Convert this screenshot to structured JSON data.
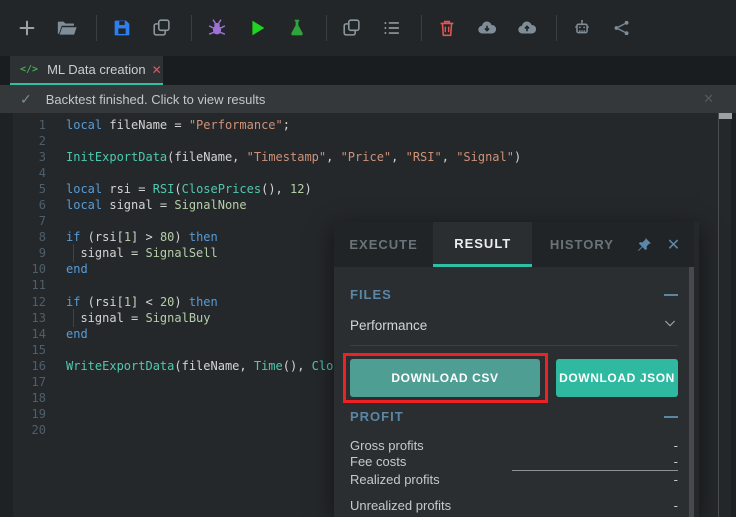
{
  "colors": {
    "accent_teal": "#2dc0a6",
    "csv_button": "#4f9e94",
    "json_button": "#2fb9a1",
    "section_header": "#5b87a5",
    "annotation_red": "#ee2222",
    "tokens": {
      "kw": "#569cd6",
      "fn": "#4ec9b0",
      "str": "#ce9178",
      "num": "#b5cea8",
      "pl": "#d4d4d4"
    }
  },
  "toolbar": {
    "groups": [
      [
        {
          "name": "new-script",
          "icon": "plus",
          "color": "#9aa2a8"
        },
        {
          "name": "open-script",
          "icon": "folder-open",
          "color": "#7e8d98"
        }
      ],
      [
        {
          "name": "save-script",
          "icon": "floppy",
          "color": "#2d7ff0"
        },
        {
          "name": "copy-script",
          "icon": "copy",
          "color": "#8d979e"
        }
      ],
      [
        {
          "name": "debug",
          "icon": "bug",
          "color": "#9d72d4"
        },
        {
          "name": "run",
          "icon": "play",
          "color": "#22d422"
        },
        {
          "name": "backtest",
          "icon": "flask",
          "color": "#2fa33c"
        }
      ],
      [
        {
          "name": "duplicate",
          "icon": "copy",
          "color": "#8d979e"
        },
        {
          "name": "log-list",
          "icon": "list",
          "color": "#8d979e"
        }
      ],
      [
        {
          "name": "delete",
          "icon": "trash",
          "color": "#e25555"
        },
        {
          "name": "cloud-download",
          "icon": "cloud-down",
          "color": "#7e8d98"
        },
        {
          "name": "cloud-upload",
          "icon": "cloud-up",
          "color": "#7e8d98"
        }
      ],
      [
        {
          "name": "bot",
          "icon": "robot",
          "color": "#7e8d98"
        },
        {
          "name": "share",
          "icon": "share",
          "color": "#7e8d98"
        }
      ]
    ]
  },
  "tab": {
    "title": "ML Data creation",
    "icon_text": "</>",
    "close_glyph": "✕"
  },
  "notification": {
    "text": "Backtest finished. Click to view results",
    "check_glyph": "✓",
    "close_glyph": "✕"
  },
  "editor": {
    "lines": [
      {
        "n": "1",
        "tokens": [
          {
            "t": "kw",
            "s": "local"
          },
          {
            "t": "pl",
            "s": " fileName = "
          },
          {
            "t": "str",
            "s": "\"Performance\""
          },
          {
            "t": "pl",
            "s": ";"
          }
        ]
      },
      {
        "n": "2",
        "tokens": []
      },
      {
        "n": "3",
        "tokens": [
          {
            "t": "fn",
            "s": "InitExportData"
          },
          {
            "t": "pl",
            "s": "(fileName, "
          },
          {
            "t": "str",
            "s": "\"Timestamp\""
          },
          {
            "t": "pl",
            "s": ", "
          },
          {
            "t": "str",
            "s": "\"Price\""
          },
          {
            "t": "pl",
            "s": ", "
          },
          {
            "t": "str",
            "s": "\"RSI\""
          },
          {
            "t": "pl",
            "s": ", "
          },
          {
            "t": "str",
            "s": "\"Signal\""
          },
          {
            "t": "pl",
            "s": ")"
          }
        ]
      },
      {
        "n": "4",
        "tokens": []
      },
      {
        "n": "5",
        "tokens": [
          {
            "t": "kw",
            "s": "local"
          },
          {
            "t": "pl",
            "s": " rsi = "
          },
          {
            "t": "fn",
            "s": "RSI"
          },
          {
            "t": "pl",
            "s": "("
          },
          {
            "t": "fn",
            "s": "ClosePrices"
          },
          {
            "t": "pl",
            "s": "(), "
          },
          {
            "t": "num",
            "s": "12"
          },
          {
            "t": "pl",
            "s": ")"
          }
        ]
      },
      {
        "n": "6",
        "tokens": [
          {
            "t": "kw",
            "s": "local"
          },
          {
            "t": "pl",
            "s": " signal = "
          },
          {
            "t": "num",
            "s": "SignalNone"
          }
        ]
      },
      {
        "n": "7",
        "tokens": []
      },
      {
        "n": "8",
        "tokens": [
          {
            "t": "kw",
            "s": "if"
          },
          {
            "t": "pl",
            "s": " (rsi["
          },
          {
            "t": "num",
            "s": "1"
          },
          {
            "t": "pl",
            "s": "] > "
          },
          {
            "t": "num",
            "s": "80"
          },
          {
            "t": "pl",
            "s": ") "
          },
          {
            "t": "kw",
            "s": "then"
          }
        ]
      },
      {
        "n": "9",
        "guide": true,
        "tokens": [
          {
            "t": "pl",
            "s": "  signal = "
          },
          {
            "t": "num",
            "s": "SignalSell"
          }
        ]
      },
      {
        "n": "10",
        "tokens": [
          {
            "t": "kw",
            "s": "end"
          }
        ]
      },
      {
        "n": "11",
        "tokens": []
      },
      {
        "n": "12",
        "tokens": [
          {
            "t": "kw",
            "s": "if"
          },
          {
            "t": "pl",
            "s": " (rsi["
          },
          {
            "t": "num",
            "s": "1"
          },
          {
            "t": "pl",
            "s": "] < "
          },
          {
            "t": "num",
            "s": "20"
          },
          {
            "t": "pl",
            "s": ") "
          },
          {
            "t": "kw",
            "s": "then"
          }
        ]
      },
      {
        "n": "13",
        "guide": true,
        "tokens": [
          {
            "t": "pl",
            "s": "  signal = "
          },
          {
            "t": "num",
            "s": "SignalBuy"
          }
        ]
      },
      {
        "n": "14",
        "tokens": [
          {
            "t": "kw",
            "s": "end"
          }
        ]
      },
      {
        "n": "15",
        "tokens": []
      },
      {
        "n": "16",
        "tokens": [
          {
            "t": "fn",
            "s": "WriteExportData"
          },
          {
            "t": "pl",
            "s": "(fileName, "
          },
          {
            "t": "fn",
            "s": "Time"
          },
          {
            "t": "pl",
            "s": "(), "
          },
          {
            "t": "fn",
            "s": "ClosePr"
          }
        ]
      },
      {
        "n": "17",
        "tokens": []
      },
      {
        "n": "18",
        "tokens": []
      },
      {
        "n": "19",
        "tokens": []
      },
      {
        "n": "20",
        "tokens": []
      }
    ]
  },
  "panel": {
    "tabs": [
      {
        "label": "EXECUTE",
        "active": false
      },
      {
        "label": "RESULT",
        "active": true
      },
      {
        "label": "HISTORY",
        "active": false
      }
    ],
    "files": {
      "title": "FILES",
      "selected_file": "Performance",
      "download_csv": "DOWNLOAD CSV",
      "download_json": "DOWNLOAD JSON"
    },
    "profit": {
      "title": "PROFIT",
      "rows": [
        {
          "label": "Gross profits",
          "value": "-"
        },
        {
          "label": "Fee costs",
          "value": "-",
          "underline_after": true
        },
        {
          "label": "Realized profits",
          "value": "-"
        },
        {
          "label": "Unrealized profits",
          "value": "-",
          "gap_before": true
        }
      ]
    }
  }
}
